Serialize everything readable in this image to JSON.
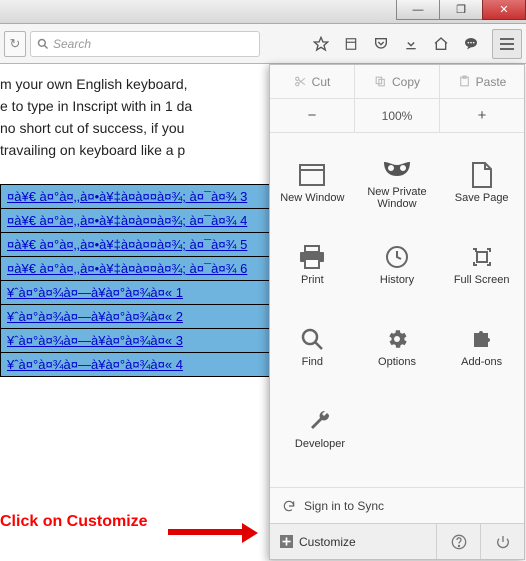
{
  "window": {
    "min": "—",
    "restore": "❐",
    "close": "✕"
  },
  "toolbar": {
    "reload": "↻",
    "search_placeholder": "Search"
  },
  "content": {
    "line1": "m your own English keyboard,",
    "line2": "e to type in Inscript with in 1 da",
    "line3": "no short cut of success, if you ",
    "line4": " travailing on keyboard like a p",
    "rows": [
      "¤à¥€ à¤°à¤‚,à¤•à¥‡à¤à¤¤à¤¾; à¤¯à¤¾ 3",
      "¤à¥€ à¤°à¤‚,à¤•à¥‡à¤à¤¤à¤¾; à¤¯à¤¾ 4",
      "¤à¥€ à¤°à¤‚,à¤•à¥‡à¤à¤¤à¤¾; à¤¯à¤¾ 5",
      "¤à¥€ à¤°à¤‚,à¤•à¥‡à¤à¤¤à¤¾; à¤¯à¤¾ 6",
      "¥ˆà¤°à¤¾à¤—à¥à¤°à¤¾à¤« 1",
      "¥ˆà¤°à¤¾à¤—à¥à¤°à¤¾à¤« 2",
      "¥ˆà¤°à¤¾à¤—à¥à¤°à¤¾à¤« 3",
      "¥ˆà¤°à¤¾à¤—à¥à¤°à¤¾à¤« 4"
    ]
  },
  "callout": "Click on Customize",
  "menu": {
    "cut": "Cut",
    "copy": "Copy",
    "paste": "Paste",
    "minus": "−",
    "zoom": "100%",
    "plus": "+",
    "items": [
      {
        "label": "New Window"
      },
      {
        "label": "New Private\nWindow"
      },
      {
        "label": "Save Page"
      },
      {
        "label": "Print"
      },
      {
        "label": "History"
      },
      {
        "label": "Full Screen"
      },
      {
        "label": "Find"
      },
      {
        "label": "Options"
      },
      {
        "label": "Add-ons"
      }
    ],
    "developer": "Developer",
    "signin": "Sign in to Sync",
    "customize": "Customize"
  }
}
